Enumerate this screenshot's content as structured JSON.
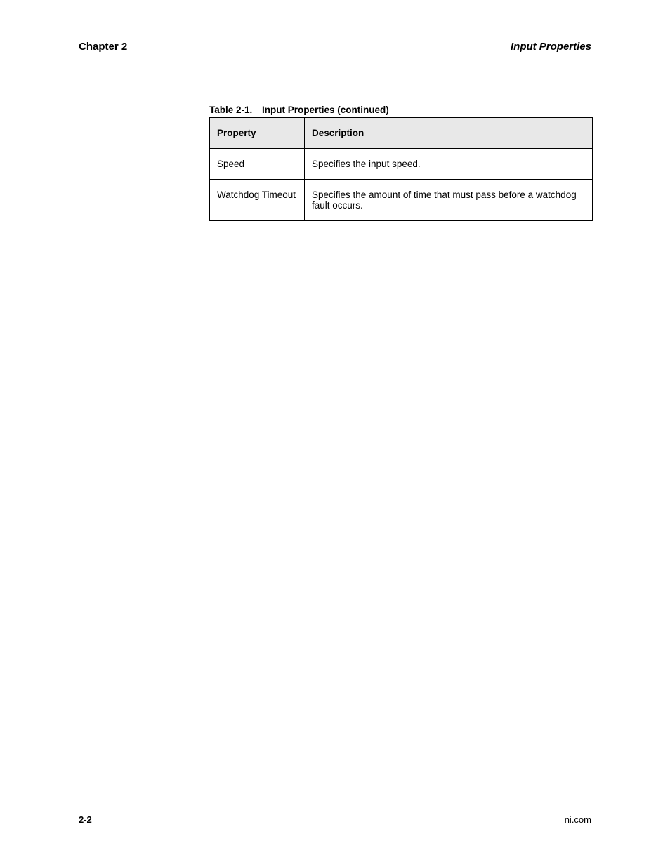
{
  "header": {
    "chapter": "Chapter 2",
    "title": "Input Properties"
  },
  "table": {
    "caption_number": "Table 2-1.",
    "caption_text": "Input Properties  (continued)",
    "headers": [
      "Property",
      "Description"
    ],
    "rows": [
      {
        "property": "Speed",
        "description": "Specifies the input speed."
      },
      {
        "property": "Watchdog Timeout",
        "description": "Specifies the amount of time that must pass before a watchdog fault occurs."
      }
    ]
  },
  "footer": {
    "page": "2-2",
    "product": "ni.com"
  }
}
